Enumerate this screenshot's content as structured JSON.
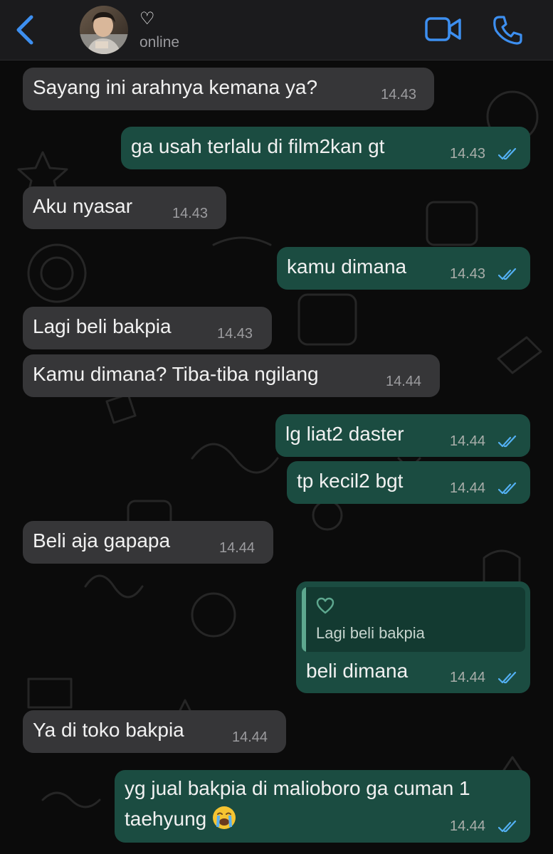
{
  "header": {
    "contact_name": "♡",
    "status": "online"
  },
  "messages": [
    {
      "side": "in",
      "text": "Sayang ini arahnya kemana ya?",
      "time": "14.43"
    },
    {
      "side": "out",
      "text": "ga usah terlalu di film2kan gt",
      "time": "14.43",
      "read": true
    },
    {
      "side": "in",
      "text": "Aku nyasar",
      "time": "14.43"
    },
    {
      "side": "out",
      "text": "kamu dimana",
      "time": "14.43",
      "read": true
    },
    {
      "side": "in",
      "text": "Lagi beli bakpia",
      "time": "14.43"
    },
    {
      "side": "in",
      "text": "Kamu dimana? Tiba-tiba ngilang",
      "time": "14.44"
    },
    {
      "side": "out",
      "text": "lg liat2 daster",
      "time": "14.44",
      "read": true
    },
    {
      "side": "out",
      "text": "tp kecil2 bgt",
      "time": "14.44",
      "read": true
    },
    {
      "side": "in",
      "text": "Beli aja gapapa",
      "time": "14.44"
    },
    {
      "side": "out",
      "text": "beli dimana",
      "time": "14.44",
      "read": true,
      "reply_to": {
        "author": "♡",
        "text": "Lagi beli bakpia"
      }
    },
    {
      "side": "in",
      "text": "Ya di toko bakpia",
      "time": "14.44"
    },
    {
      "side": "out",
      "text_line1": "yg jual bakpia di malioboro ga cuman 1",
      "text_line2": "taehyung",
      "emoji": "loudly-crying-face",
      "time": "14.44",
      "read": true
    }
  ],
  "colors": {
    "accent_blue": "#3d8ff0",
    "incoming_bubble": "#363638",
    "outgoing_bubble": "#1b4c41",
    "read_ticks": "#53b0f3"
  }
}
